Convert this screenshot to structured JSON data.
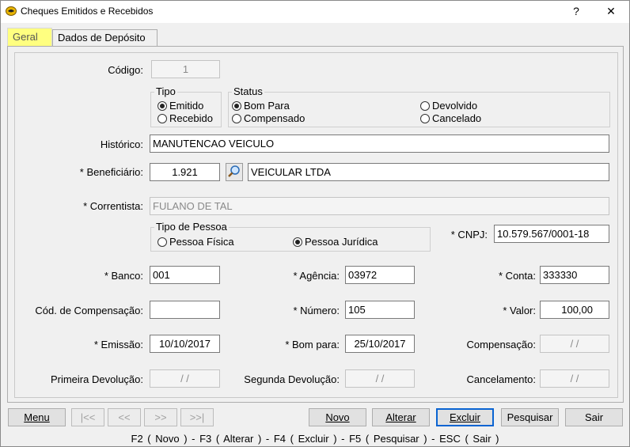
{
  "window": {
    "title": "Cheques Emitidos e Recebidos",
    "help_label": "?",
    "close_label": "✕"
  },
  "tabs": [
    {
      "label": "Geral",
      "active": true
    },
    {
      "label": "Dados de Depósito",
      "active": false
    }
  ],
  "form": {
    "codigo": {
      "label": "Código:",
      "value": "1"
    },
    "tipo": {
      "title": "Tipo",
      "options": [
        {
          "label": "Emitido",
          "checked": true
        },
        {
          "label": "Recebido",
          "checked": false
        }
      ]
    },
    "status": {
      "title": "Status",
      "options": [
        {
          "label": "Bom Para",
          "checked": true
        },
        {
          "label": "Compensado",
          "checked": false
        },
        {
          "label": "Devolvido",
          "checked": false
        },
        {
          "label": "Cancelado",
          "checked": false
        }
      ]
    },
    "historico": {
      "label": "Histórico:",
      "value": "MANUTENCAO VEICULO"
    },
    "beneficiario": {
      "label": "* Beneficiário:",
      "code": "1.921",
      "name": "VEICULAR LTDA",
      "search_icon": "magnifier-icon"
    },
    "correntista": {
      "label": "* Correntista:",
      "value": "FULANO DE TAL"
    },
    "tipo_pessoa": {
      "title": "Tipo de Pessoa",
      "options": [
        {
          "label": "Pessoa Física",
          "checked": false
        },
        {
          "label": "Pessoa Jurídica",
          "checked": true
        }
      ]
    },
    "cnpj": {
      "label": "* CNPJ:",
      "value": "10.579.567/0001-18"
    },
    "banco": {
      "label": "* Banco:",
      "value": "001"
    },
    "agencia": {
      "label": "* Agência:",
      "value": "03972"
    },
    "conta": {
      "label": "* Conta:",
      "value": "333330"
    },
    "cod_compensacao": {
      "label": "Cód. de Compensação:",
      "value": ""
    },
    "numero": {
      "label": "* Número:",
      "value": "105"
    },
    "valor": {
      "label": "* Valor:",
      "value": "100,00"
    },
    "emissao": {
      "label": "* Emissão:",
      "value": "10/10/2017"
    },
    "bom_para": {
      "label": "* Bom para:",
      "value": "25/10/2017"
    },
    "compensacao": {
      "label": "Compensação:",
      "value": "/ /"
    },
    "primeira_devolucao": {
      "label": "Primeira Devolução:",
      "value": "/ /"
    },
    "segunda_devolucao": {
      "label": "Segunda Devolução:",
      "value": "/ /"
    },
    "cancelamento": {
      "label": "Cancelamento:",
      "value": "/ /"
    }
  },
  "buttons": {
    "menu": "Menu",
    "first": "|<<",
    "prev": "<<",
    "next": ">>",
    "last": ">>|",
    "novo": "Novo",
    "alterar": "Alterar",
    "excluir": "Excluir",
    "pesquisar": "Pesquisar",
    "sair": "Sair"
  },
  "shortcuts": "F2 ( Novo )  -  F3 ( Alterar )  -  F4 ( Excluir )  -  F5 ( Pesquisar )  -  ESC ( Sair )",
  "colors": {
    "active_tab": "#ffff80",
    "focus_border": "#0a64d2",
    "app_icon": "#e8b400"
  }
}
